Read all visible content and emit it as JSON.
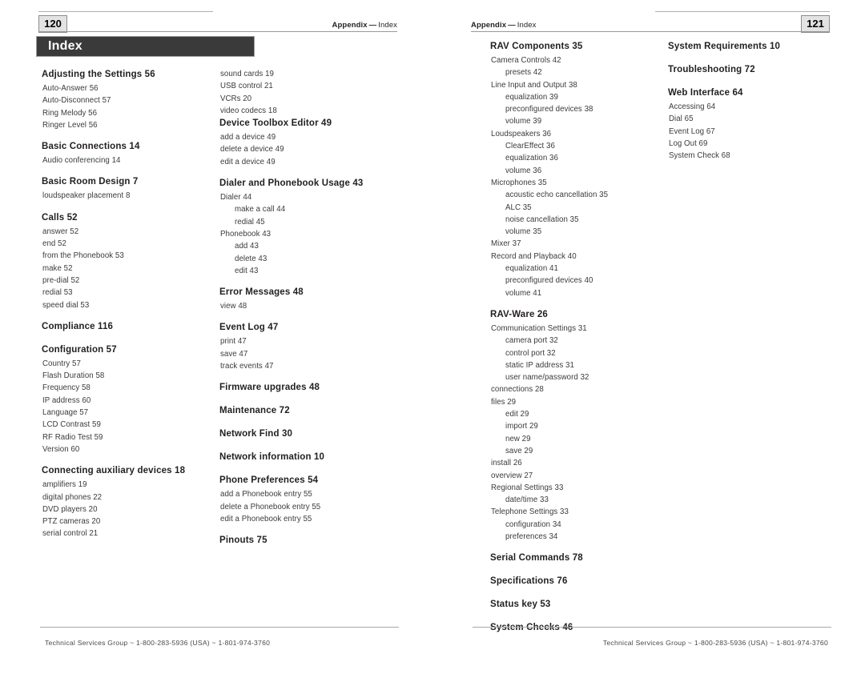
{
  "document": {
    "title": "Index",
    "footer_text": "Technical Services Group ~ 1-800-283-5936 (USA) ~ 1-801-974-3760"
  },
  "left_page": {
    "page_number": "120",
    "header_section": "Appendix",
    "header_dash": "—",
    "header_topic": "Index",
    "title_bar": "Index",
    "column1": [
      {
        "level": 0,
        "text": "Adjusting the Settings 56",
        "gap": false
      },
      {
        "level": 1,
        "text": "Auto-Answer 56",
        "gap": false
      },
      {
        "level": 1,
        "text": "Auto-Disconnect 57",
        "gap": false
      },
      {
        "level": 1,
        "text": "Ring Melody 56",
        "gap": false
      },
      {
        "level": 1,
        "text": "Ringer Level 56",
        "gap": false
      },
      {
        "level": 0,
        "text": "Basic Connections 14",
        "gap": true
      },
      {
        "level": 1,
        "text": "Audio conferencing 14",
        "gap": false
      },
      {
        "level": 0,
        "text": "Basic Room Design  7",
        "gap": true
      },
      {
        "level": 1,
        "text": "loudspeaker placement 8",
        "gap": false
      },
      {
        "level": 0,
        "text": "Calls 52",
        "gap": true
      },
      {
        "level": 1,
        "text": "answer 52",
        "gap": false
      },
      {
        "level": 1,
        "text": "end 52",
        "gap": false
      },
      {
        "level": 1,
        "text": "from the Phonebook 53",
        "gap": false
      },
      {
        "level": 1,
        "text": "make 52",
        "gap": false
      },
      {
        "level": 1,
        "text": "pre-dial 52",
        "gap": false
      },
      {
        "level": 1,
        "text": "redial 53",
        "gap": false
      },
      {
        "level": 1,
        "text": "speed dial 53",
        "gap": false
      },
      {
        "level": 0,
        "text": "Compliance 116",
        "gap": true
      },
      {
        "level": 0,
        "text": "Configuration 57",
        "gap": true
      },
      {
        "level": 1,
        "text": "Country 57",
        "gap": false
      },
      {
        "level": 1,
        "text": "Flash Duration 58",
        "gap": false
      },
      {
        "level": 1,
        "text": "Frequency 58",
        "gap": false
      },
      {
        "level": 1,
        "text": "IP address 60",
        "gap": false
      },
      {
        "level": 1,
        "text": "Language 57",
        "gap": false
      },
      {
        "level": 1,
        "text": "LCD Contrast 59",
        "gap": false
      },
      {
        "level": 1,
        "text": "RF Radio Test 59",
        "gap": false
      },
      {
        "level": 1,
        "text": "Version 60",
        "gap": false
      },
      {
        "level": 0,
        "text": "Connecting auxiliary devices 18",
        "gap": true
      },
      {
        "level": 1,
        "text": "amplifiers 19",
        "gap": false
      },
      {
        "level": 1,
        "text": "digital phones 22",
        "gap": false
      },
      {
        "level": 1,
        "text": "DVD players 20",
        "gap": false
      },
      {
        "level": 1,
        "text": "PTZ cameras 20",
        "gap": false
      },
      {
        "level": 1,
        "text": "serial control 21",
        "gap": false
      }
    ],
    "column2": [
      {
        "level": 1,
        "text": "sound cards 19",
        "gap": false
      },
      {
        "level": 1,
        "text": "USB control 21",
        "gap": false
      },
      {
        "level": 1,
        "text": "VCRs 20",
        "gap": false
      },
      {
        "level": 1,
        "text": "video codecs 18",
        "gap": false
      },
      {
        "level": 0,
        "text": "Device Toolbox Editor 49",
        "gap": false
      },
      {
        "level": 1,
        "text": "add a device 49",
        "gap": false
      },
      {
        "level": 1,
        "text": "delete a device 49",
        "gap": false
      },
      {
        "level": 1,
        "text": "edit a device 49",
        "gap": false
      },
      {
        "level": 0,
        "text": "Dialer and Phonebook Usage 43",
        "gap": true
      },
      {
        "level": 1,
        "text": "Dialer 44",
        "gap": false
      },
      {
        "level": 2,
        "text": "make a call 44",
        "gap": false
      },
      {
        "level": 2,
        "text": "redial 45",
        "gap": false
      },
      {
        "level": 1,
        "text": "Phonebook 43",
        "gap": false
      },
      {
        "level": 2,
        "text": "add 43",
        "gap": false
      },
      {
        "level": 2,
        "text": "delete 43",
        "gap": false
      },
      {
        "level": 2,
        "text": "edit 43",
        "gap": false
      },
      {
        "level": 0,
        "text": "Error Messages 48",
        "gap": true
      },
      {
        "level": 1,
        "text": "view 48",
        "gap": false
      },
      {
        "level": 0,
        "text": "Event Log 47",
        "gap": true
      },
      {
        "level": 1,
        "text": "print 47",
        "gap": false
      },
      {
        "level": 1,
        "text": "save 47",
        "gap": false
      },
      {
        "level": 1,
        "text": "track events 47",
        "gap": false
      },
      {
        "level": 0,
        "text": "Firmware upgrades 48",
        "gap": true
      },
      {
        "level": 0,
        "text": "Maintenance 72",
        "gap": true
      },
      {
        "level": 0,
        "text": "Network Find 30",
        "gap": true
      },
      {
        "level": 0,
        "text": "Network information 10",
        "gap": true
      },
      {
        "level": 0,
        "text": "Phone Preferences 54",
        "gap": true
      },
      {
        "level": 1,
        "text": "add a Phonebook entry 55",
        "gap": false
      },
      {
        "level": 1,
        "text": "delete a Phonebook entry 55",
        "gap": false
      },
      {
        "level": 1,
        "text": "edit a Phonebook entry 55",
        "gap": false
      },
      {
        "level": 0,
        "text": "Pinouts 75",
        "gap": true
      }
    ]
  },
  "right_page": {
    "page_number": "121",
    "header_section": "Appendix",
    "header_dash": "—",
    "header_topic": "Index",
    "column1": [
      {
        "level": 0,
        "text": "RAV Components 35",
        "gap": false
      },
      {
        "level": 1,
        "text": "Camera Controls 42",
        "gap": false
      },
      {
        "level": 2,
        "text": "presets 42",
        "gap": false
      },
      {
        "level": 1,
        "text": "Line Input and Output 38",
        "gap": false
      },
      {
        "level": 2,
        "text": "equalization 39",
        "gap": false
      },
      {
        "level": 2,
        "text": "preconfigured devices 38",
        "gap": false
      },
      {
        "level": 2,
        "text": "volume 39",
        "gap": false
      },
      {
        "level": 1,
        "text": "Loudspeakers 36",
        "gap": false
      },
      {
        "level": 2,
        "text": "ClearEffect 36",
        "gap": false
      },
      {
        "level": 2,
        "text": "equalization 36",
        "gap": false
      },
      {
        "level": 2,
        "text": "volume 36",
        "gap": false
      },
      {
        "level": 1,
        "text": "Microphones 35",
        "gap": false
      },
      {
        "level": 2,
        "text": "acoustic echo cancellation 35",
        "gap": false
      },
      {
        "level": 2,
        "text": "ALC 35",
        "gap": false
      },
      {
        "level": 2,
        "text": "noise cancellation 35",
        "gap": false
      },
      {
        "level": 2,
        "text": "volume 35",
        "gap": false
      },
      {
        "level": 1,
        "text": "Mixer 37",
        "gap": false
      },
      {
        "level": 1,
        "text": "Record and Playback 40",
        "gap": false
      },
      {
        "level": 2,
        "text": "equalization 41",
        "gap": false
      },
      {
        "level": 2,
        "text": "preconfigured devices 40",
        "gap": false
      },
      {
        "level": 2,
        "text": "volume 41",
        "gap": false
      },
      {
        "level": 0,
        "text": "RAV-Ware 26",
        "gap": true
      },
      {
        "level": 1,
        "text": "Communication Settings 31",
        "gap": false
      },
      {
        "level": 2,
        "text": "camera port 32",
        "gap": false
      },
      {
        "level": 2,
        "text": "control port 32",
        "gap": false
      },
      {
        "level": 2,
        "text": "static IP address 31",
        "gap": false
      },
      {
        "level": 2,
        "text": "user name/password 32",
        "gap": false
      },
      {
        "level": 1,
        "text": "connections 28",
        "gap": false
      },
      {
        "level": 1,
        "text": "files 29",
        "gap": false
      },
      {
        "level": 2,
        "text": "edit 29",
        "gap": false
      },
      {
        "level": 2,
        "text": "import 29",
        "gap": false
      },
      {
        "level": 2,
        "text": "new 29",
        "gap": false
      },
      {
        "level": 2,
        "text": "save 29",
        "gap": false
      },
      {
        "level": 1,
        "text": "install 26",
        "gap": false
      },
      {
        "level": 1,
        "text": "overview 27",
        "gap": false
      },
      {
        "level": 1,
        "text": "Regional Settings 33",
        "gap": false
      },
      {
        "level": 2,
        "text": "date/time 33",
        "gap": false
      },
      {
        "level": 1,
        "text": "Telephone Settings 33",
        "gap": false
      },
      {
        "level": 2,
        "text": "configuration 34",
        "gap": false
      },
      {
        "level": 2,
        "text": "preferences 34",
        "gap": false
      },
      {
        "level": 0,
        "text": "Serial Commands 78",
        "gap": true
      },
      {
        "level": 0,
        "text": "Specifications 76",
        "gap": true
      },
      {
        "level": 0,
        "text": "Status key 53",
        "gap": true
      },
      {
        "level": 0,
        "text": "System Checks 46",
        "gap": true
      }
    ],
    "column2": [
      {
        "level": 0,
        "text": "System Requirements 10",
        "gap": false
      },
      {
        "level": 0,
        "text": "Troubleshooting 72",
        "gap": true
      },
      {
        "level": 0,
        "text": "Web Interface 64",
        "gap": true
      },
      {
        "level": 1,
        "text": "Accessing 64",
        "gap": false
      },
      {
        "level": 1,
        "text": "Dial 65",
        "gap": false
      },
      {
        "level": 1,
        "text": "Event Log 67",
        "gap": false
      },
      {
        "level": 1,
        "text": "Log Out 69",
        "gap": false
      },
      {
        "level": 1,
        "text": "System Check 68",
        "gap": false
      }
    ]
  }
}
